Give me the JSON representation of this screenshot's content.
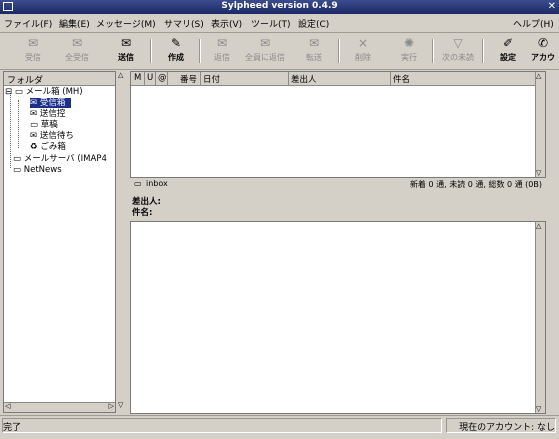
{
  "window": {
    "title": "Sylpheed version 0.4.9",
    "close": "✕"
  },
  "menu": [
    "ファイル(F)",
    "編集(E)",
    "メッセージ(M)",
    "サマリ(S)",
    "表示(V)",
    "ツール(T)",
    "設定(C)",
    "ヘルプ(H)"
  ],
  "toolbar": [
    {
      "label": "受信",
      "icon": "mail-receive-icon",
      "enabled": false
    },
    {
      "label": "全受信",
      "icon": "mail-receive-all-icon",
      "enabled": false
    },
    {
      "label": "送信",
      "icon": "mail-send-icon",
      "enabled": true
    },
    {
      "label": "作成",
      "icon": "mail-compose-icon",
      "enabled": true
    },
    {
      "label": "返信",
      "icon": "reply-icon",
      "enabled": false
    },
    {
      "label": "全員に返信",
      "icon": "reply-all-icon",
      "enabled": false
    },
    {
      "label": "転送",
      "icon": "forward-icon",
      "enabled": false
    },
    {
      "label": "削除",
      "icon": "delete-icon",
      "enabled": false
    },
    {
      "label": "実行",
      "icon": "execute-icon",
      "enabled": false
    },
    {
      "label": "次の未読",
      "icon": "next-unread-icon",
      "enabled": false
    },
    {
      "label": "設定",
      "icon": "preferences-icon",
      "enabled": true
    },
    {
      "label": "アカウ",
      "icon": "account-icon",
      "enabled": true
    }
  ],
  "folders": {
    "header": "フォルダ",
    "items": [
      {
        "label": "メール箱 (MH)",
        "level": 0,
        "selected": false
      },
      {
        "label": "受信箱",
        "level": 1,
        "selected": true
      },
      {
        "label": "送信控",
        "level": 1,
        "selected": false
      },
      {
        "label": "草稿",
        "level": 1,
        "selected": false
      },
      {
        "label": "送信待ち",
        "level": 1,
        "selected": false
      },
      {
        "label": "ごみ箱",
        "level": 1,
        "selected": false
      },
      {
        "label": "メールサーバ (IMAP4",
        "level": 0,
        "selected": false
      },
      {
        "label": "NetNews",
        "level": 0,
        "selected": false
      }
    ]
  },
  "list": {
    "columns": [
      "M",
      "U",
      "@",
      "番号",
      "日付",
      "差出人",
      "件名"
    ]
  },
  "summary": {
    "folder": "inbox",
    "counts": "新着 0 通, 未読 0 通, 総数 0 通 (0B)"
  },
  "message": {
    "from_label": "差出人:",
    "subject_label": "件名:"
  },
  "status": {
    "text": "完了",
    "account": "現在のアカウント: なし"
  },
  "colors": {
    "selection": "#1c2f8a",
    "titlebar": "#1b2a66"
  }
}
